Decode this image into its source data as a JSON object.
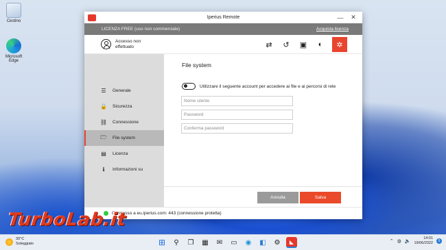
{
  "desktop": {
    "icons": [
      {
        "label": "Cestino",
        "icon": "recycle-bin-icon"
      },
      {
        "label": "Microsoft Edge",
        "icon": "edge-icon"
      }
    ]
  },
  "window": {
    "title": "Iperius Remote",
    "minimize_glyph": "—",
    "close_glyph": "✕"
  },
  "license": {
    "text": "LICENZA FREE (uso non commerciale)",
    "link": "Acquista licenza"
  },
  "toolbar": {
    "user_status": "Accesso non effettuato",
    "icons": [
      {
        "name": "transfer-icon",
        "glyph": "⇄"
      },
      {
        "name": "history-icon",
        "glyph": "↺"
      },
      {
        "name": "contacts-icon",
        "glyph": "▣"
      },
      {
        "name": "shield-icon",
        "glyph": "◐"
      },
      {
        "name": "settings-icon",
        "glyph": "✲"
      }
    ]
  },
  "sidebar": {
    "items": [
      {
        "label": "Generale",
        "icon": "sliders-icon",
        "glyph": "☰"
      },
      {
        "label": "Sicurezza",
        "icon": "lock-icon",
        "glyph": "🔒"
      },
      {
        "label": "Connessione",
        "icon": "link-icon",
        "glyph": "⛓"
      },
      {
        "label": "File system",
        "icon": "folder-icon",
        "glyph": "🗁"
      },
      {
        "label": "Licenza",
        "icon": "document-icon",
        "glyph": "▤"
      },
      {
        "label": "Informazioni su",
        "icon": "info-icon",
        "glyph": "ℹ"
      }
    ],
    "active": "File system"
  },
  "content": {
    "title": "File system",
    "toggle_label": "Utilizzare il seguente account per accedere ai file e ai percorsi di rete",
    "toggle_on": false,
    "fields": {
      "username_placeholder": "Nome utente",
      "password_placeholder": "Password",
      "confirm_placeholder": "Conferma password"
    },
    "buttons": {
      "cancel": "Annulla",
      "save": "Salva"
    }
  },
  "status": {
    "text": "Connesso a eu.iperius.com: 443 (connessione protetta)",
    "color": "#2ecc40"
  },
  "watermark": "TurboLab.it",
  "taskbar": {
    "weather_temp": "30°C",
    "weather_desc": "Soleggiato",
    "time": "14:01",
    "date": "19/06/2022",
    "notification_count": "5"
  }
}
